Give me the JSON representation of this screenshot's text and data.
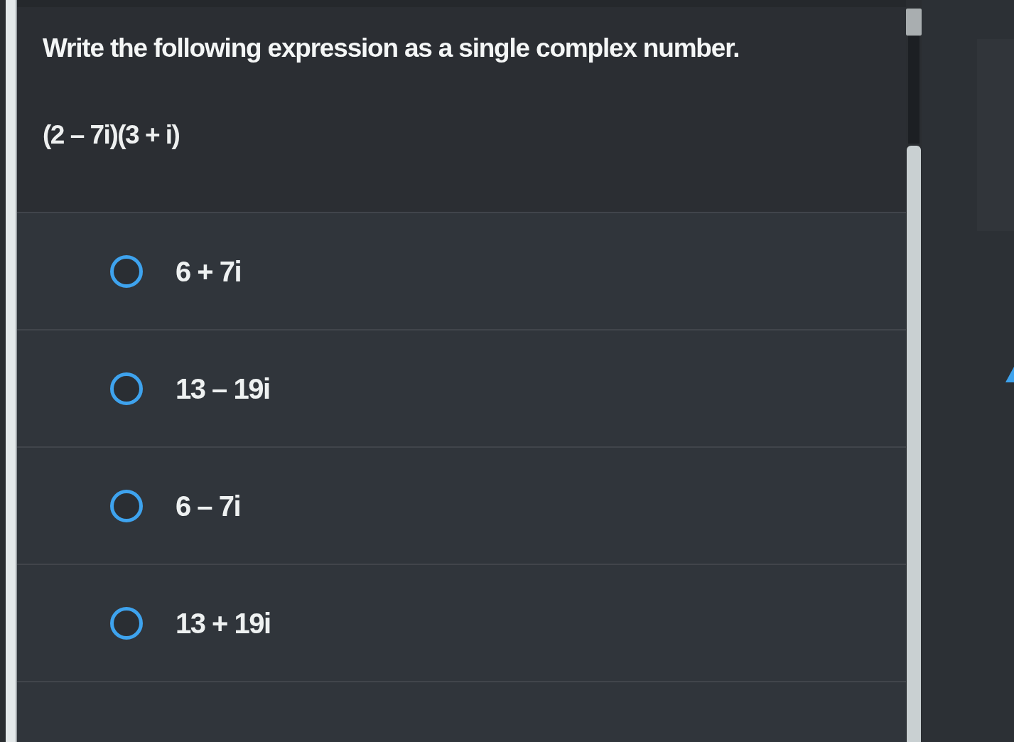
{
  "question": {
    "prompt": "Write the following expression as a single complex number.",
    "expression": "(2 – 7i)(3 + i)"
  },
  "choices": [
    {
      "label": "6 + 7i",
      "selected": false
    },
    {
      "label": "13 – 19i",
      "selected": false
    },
    {
      "label": "6 – 7i",
      "selected": false
    },
    {
      "label": "13 + 19i",
      "selected": false
    }
  ]
}
